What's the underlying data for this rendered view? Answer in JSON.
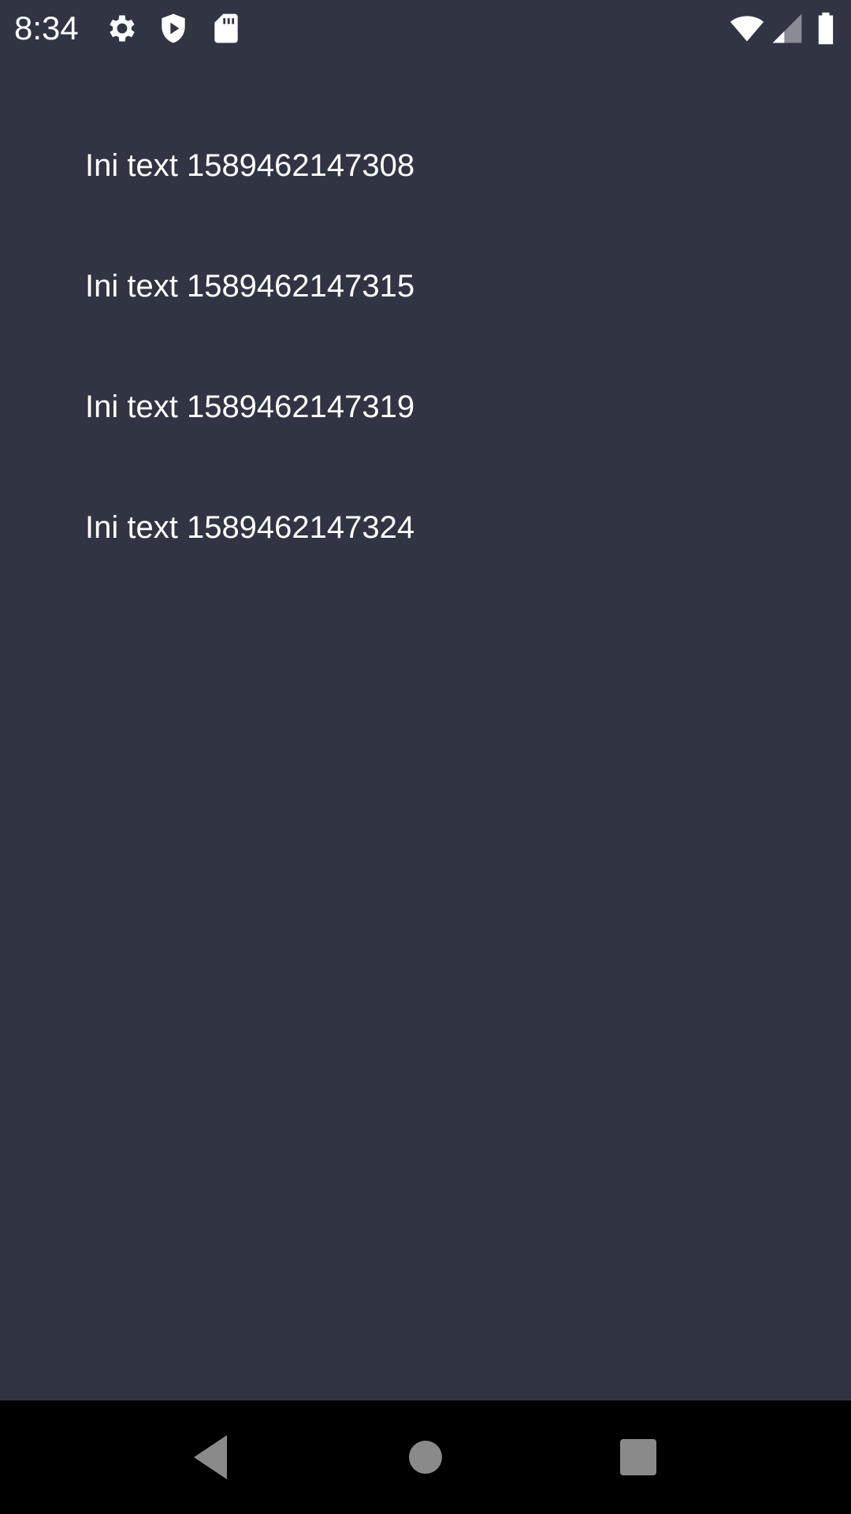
{
  "status_bar": {
    "time": "8:34",
    "icons": [
      "settings-gear-icon",
      "shield-play-icon",
      "sd-card-icon",
      "wifi-icon",
      "cell-signal-icon",
      "battery-icon"
    ]
  },
  "list": {
    "items": [
      {
        "label": "Ini text 1589462147308"
      },
      {
        "label": "Ini text 1589462147315"
      },
      {
        "label": "Ini text 1589462147319"
      },
      {
        "label": "Ini text 1589462147324"
      }
    ]
  },
  "nav_bar": {
    "buttons": [
      "back",
      "home",
      "recents"
    ]
  },
  "colors": {
    "background": "#303443",
    "text": "#ffffff",
    "nav_background": "#000000",
    "nav_icon": "#8a8a8a"
  }
}
